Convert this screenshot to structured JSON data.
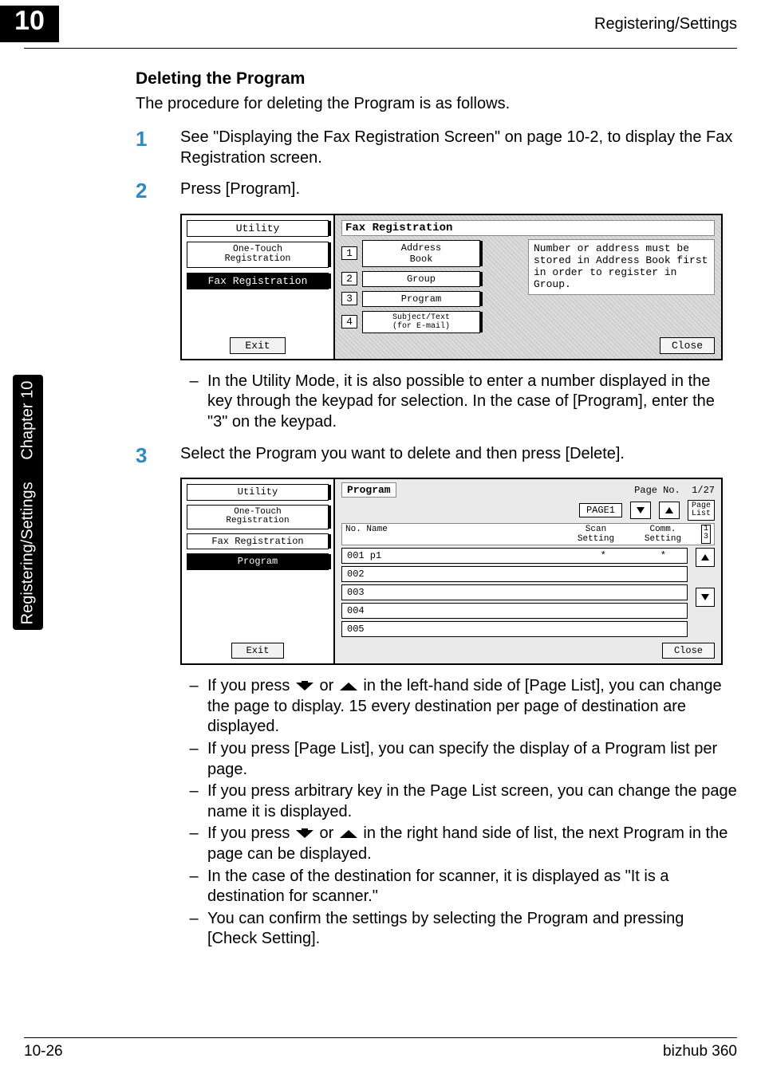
{
  "header": {
    "chapter_number": "10",
    "running_head": "Registering/Settings"
  },
  "side_tab": {
    "lower": "Registering/Settings",
    "upper": "Chapter 10"
  },
  "section": {
    "title": "Deleting the Program",
    "lead": "The procedure for deleting the Program is as follows."
  },
  "steps": {
    "s1": {
      "num": "1",
      "text": "See \"Displaying the Fax Registration Screen\" on page 10-2, to display the Fax Registration screen."
    },
    "s2": {
      "num": "2",
      "text": "Press [Program]."
    },
    "s2_notes": {
      "n1": "In the Utility Mode, it is also possible to enter a number displayed in the key through the keypad for selection. In the case of [Program], enter the \"3\" on the keypad."
    },
    "s3": {
      "num": "3",
      "text": "Select the Program you want to delete and then press [Delete]."
    },
    "s3_notes": {
      "n1_a": "If you press ",
      "n1_b": " or ",
      "n1_c": " in the left-hand side of [Page List], you can change the page to display. 15 every destination per page of destination are displayed.",
      "n2": "If you press [Page List], you can specify the display of a Program list per page.",
      "n3": "If you press arbitrary key in the Page List screen, you can change the page name it is displayed.",
      "n4_a": "If you press ",
      "n4_b": " or ",
      "n4_c": " in the right hand side of list, the next Program in the page can be displayed.",
      "n5": "In the case of the destination for scanner, it is displayed as \"It is a destination for scanner.\"",
      "n6": "You can confirm the settings by selecting the Program and pressing [Check Setting]."
    }
  },
  "lcd1": {
    "side": {
      "utility": "Utility",
      "onetouch": "One-Touch\nRegistration",
      "faxreg": "Fax Registration",
      "exit": "Exit"
    },
    "title": "Fax Registration",
    "btn1_num": "1",
    "btn1_label": "Address\nBook",
    "btn2_num": "2",
    "btn2_label": "Group",
    "btn3_num": "3",
    "btn3_label": "Program",
    "btn4_num": "4",
    "btn4_label": "Subject/Text\n(for E-mail)",
    "note": "Number or address must be stored in Address Book first in order to register in Group.",
    "close": "Close"
  },
  "lcd2": {
    "side": {
      "utility": "Utility",
      "onetouch": "One-Touch\nRegistration",
      "faxreg": "Fax Registration",
      "program": "Program",
      "exit": "Exit"
    },
    "program_label": "Program",
    "page_no_label": "Page No.",
    "page_no_value": "1/27",
    "page_box": "PAGE1",
    "page_list_btn": "Page\nList",
    "head_no_name": "No. Name",
    "head_scan": "Scan\nSetting",
    "head_comm": "Comm.\nSetting",
    "frac": "1\n3",
    "rows": {
      "r1": "001 p1",
      "r1_star": "*",
      "r1_star2": "*",
      "r2": "002",
      "r3": "003",
      "r4": "004",
      "r5": "005"
    },
    "close": "Close"
  },
  "footer": {
    "page": "10-26",
    "product": "bizhub 360"
  }
}
